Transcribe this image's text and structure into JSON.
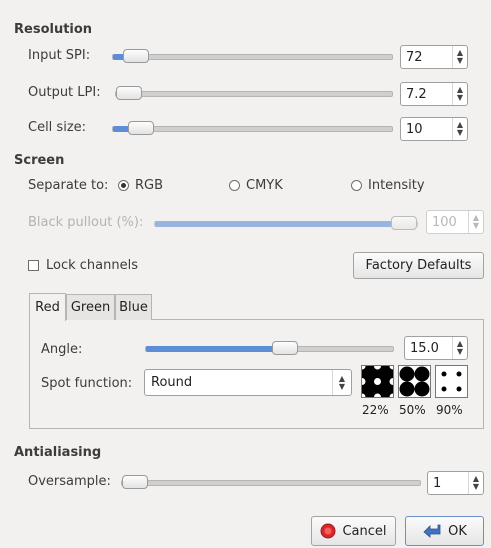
{
  "resolution": {
    "title": "Resolution",
    "input_spi": {
      "label": "Input SPI:",
      "value": "72",
      "level": 0.04
    },
    "output_lpi": {
      "label": "Output LPI:",
      "value": "7.2",
      "level": 0.0
    },
    "cell_size": {
      "label": "Cell size:",
      "value": "10",
      "level": 0.06
    }
  },
  "screen": {
    "title": "Screen",
    "separate_to_label": "Separate to:",
    "options": [
      {
        "label": "RGB",
        "selected": true
      },
      {
        "label": "CMYK",
        "selected": false
      },
      {
        "label": "Intensity",
        "selected": false
      }
    ],
    "black_pullout": {
      "label": "Black pullout (%):",
      "value": "100",
      "level": 1.0,
      "disabled": true
    },
    "lock_channels": {
      "label": "Lock channels",
      "checked": false
    },
    "factory_defaults": "Factory Defaults"
  },
  "tabs": [
    {
      "label": "Red",
      "active": true
    },
    {
      "label": "Green",
      "active": false
    },
    {
      "label": "Blue",
      "active": false
    }
  ],
  "channel": {
    "angle": {
      "label": "Angle:",
      "value": "15.0",
      "level": 0.57
    },
    "spot_function": {
      "label": "Spot function:",
      "value": "Round"
    },
    "previews": [
      "22%",
      "50%",
      "90%"
    ]
  },
  "antialiasing": {
    "title": "Antialiasing",
    "oversample": {
      "label": "Oversample:",
      "value": "1",
      "level": 0.0
    }
  },
  "buttons": {
    "cancel": "Cancel",
    "ok": "OK"
  },
  "colors": {
    "accent": "#5b8ed6",
    "cancel_icon": "#d9262b",
    "ok_icon": "#3f74c3"
  },
  "icons": {
    "cancel": "cancel-icon",
    "ok": "ok-arrow-icon"
  }
}
